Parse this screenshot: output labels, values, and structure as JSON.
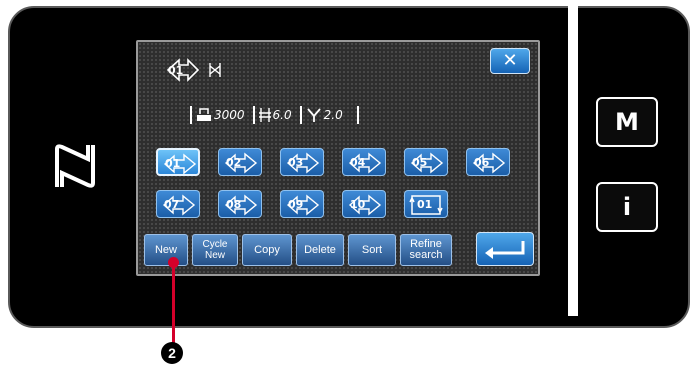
{
  "side_buttons": {
    "mode": "M",
    "info": "i"
  },
  "header": {
    "pattern_number": "01"
  },
  "info_line": {
    "speed": "3000",
    "stitch_length": "6.0",
    "bobbin": "2.0"
  },
  "patterns": [
    {
      "number": "01",
      "selected": true
    },
    {
      "number": "02",
      "selected": false
    },
    {
      "number": "03",
      "selected": false
    },
    {
      "number": "04",
      "selected": false
    },
    {
      "number": "05",
      "selected": false
    },
    {
      "number": "06",
      "selected": false
    },
    {
      "number": "07",
      "selected": false
    },
    {
      "number": "08",
      "selected": false
    },
    {
      "number": "09",
      "selected": false
    },
    {
      "number": "10",
      "selected": false
    }
  ],
  "cycle_pattern": {
    "number": "01"
  },
  "commands": {
    "new": "New",
    "cycle_new_line1": "Cycle",
    "cycle_new_line2": "New",
    "copy": "Copy",
    "delete": "Delete",
    "sort": "Sort",
    "refine_line1": "Refine",
    "refine_line2": "search"
  },
  "callout": {
    "number": "2"
  },
  "colors": {
    "button_blue": "#2b6fc0",
    "selected_blue": "#5bb6f5",
    "callout_red": "#d4002a"
  }
}
